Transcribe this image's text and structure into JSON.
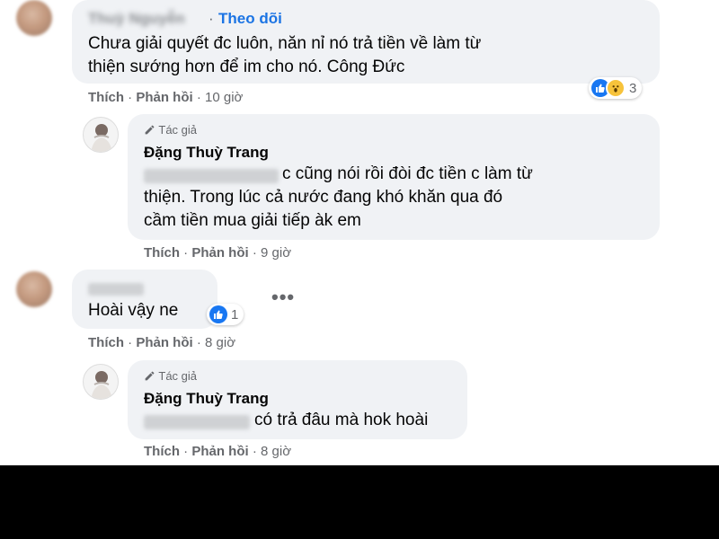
{
  "comments": [
    {
      "name": "Thuỳ Nguyễn",
      "follow_label": "Theo dõi",
      "text_line1": "Chưa giải quyết đc luôn, năn nỉ nó trả tiền về làm từ",
      "text_line2": "thiện sướng hơn để im cho nó. Công Đức",
      "like": "Thích",
      "reply": "Phản hồi",
      "time": "10 giờ",
      "reactions": [
        "like",
        "wow"
      ],
      "reaction_count": "3"
    },
    {
      "author_badge": "Tác giả",
      "name": "Đặng Thuỳ Trang",
      "text_line1": "c cũng nói rồi đòi đc tiền c làm từ",
      "text_line2": "thiện. Trong lúc cả nước đang khó khăn qua đó",
      "text_line3": "cầm tiền mua giải tiếp àk em",
      "like": "Thích",
      "reply": "Phản hồi",
      "time": "9 giờ"
    },
    {
      "text": "Hoài vậy ne",
      "reactions": [
        "like"
      ],
      "reaction_count": "1",
      "like": "Thích",
      "reply": "Phản hồi",
      "time": "8 giờ",
      "more": "•••"
    },
    {
      "author_badge": "Tác giả",
      "name": "Đặng Thuỳ Trang",
      "text": "có trả đâu mà hok hoài",
      "like": "Thích",
      "reply": "Phản hồi",
      "time": "8 giờ"
    }
  ],
  "colors": {
    "accent": "#1b74e4",
    "bubble": "#f0f2f5",
    "meta": "#65676b"
  },
  "icons": {
    "badge": "pencil-icon",
    "like": "thumbs-up-icon",
    "wow": "wow-face-icon",
    "more": "more-dots-icon"
  }
}
